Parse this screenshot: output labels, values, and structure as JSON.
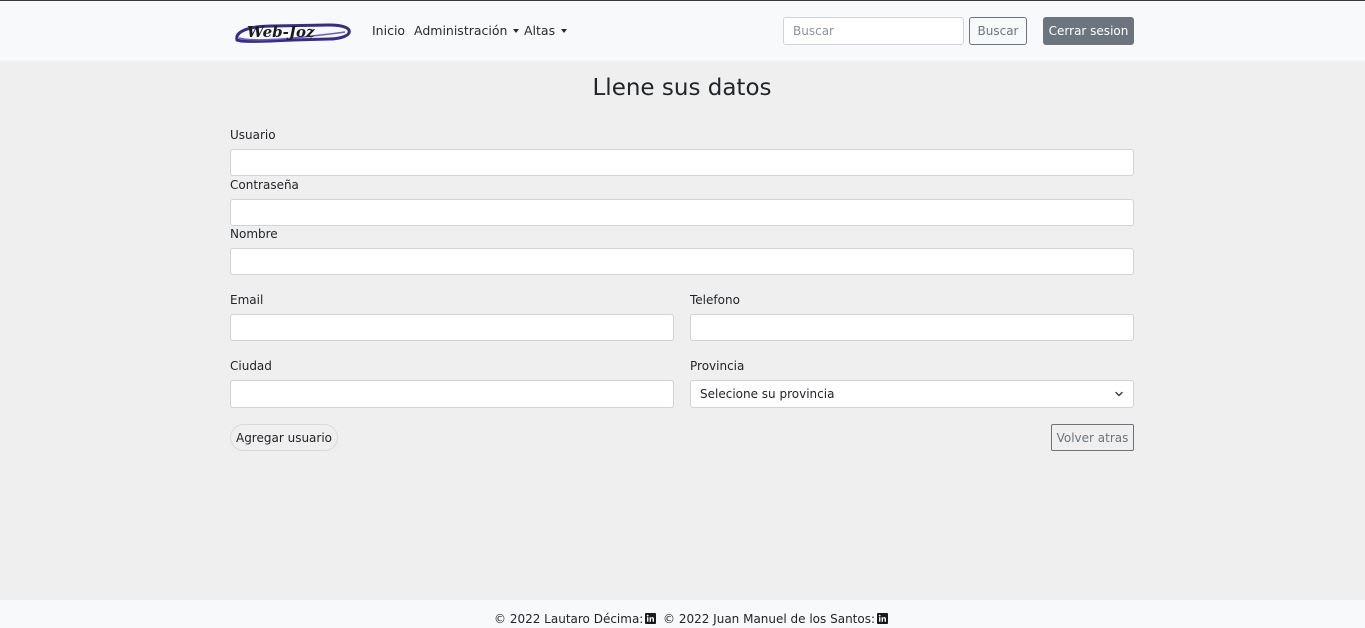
{
  "navbar": {
    "brand_text": "Web-Joz",
    "links": {
      "inicio": "Inicio",
      "administracion": "Administración",
      "altas": "Altas"
    },
    "search": {
      "placeholder": "Buscar",
      "value": ""
    },
    "search_button": "Buscar",
    "logout_button": "Cerrar sesion"
  },
  "form": {
    "title": "Llene sus datos",
    "fields": {
      "usuario": {
        "label": "Usuario",
        "value": ""
      },
      "contrasena": {
        "label": "Contraseña",
        "value": ""
      },
      "nombre": {
        "label": "Nombre",
        "value": ""
      },
      "email": {
        "label": "Email",
        "value": ""
      },
      "telefono": {
        "label": "Telefono",
        "value": ""
      },
      "ciudad": {
        "label": "Ciudad",
        "value": ""
      },
      "provincia": {
        "label": "Provincia",
        "selected": "Selecione su provincia"
      }
    },
    "add_button": "Agregar usuario",
    "back_button": "Volver atras"
  },
  "footer": {
    "credits": [
      {
        "text": "© 2022 Lautaro Décima:",
        "icon": "linkedin-icon"
      },
      {
        "text": "© 2022 Juan Manuel de los Santos:",
        "icon": "linkedin-icon"
      }
    ]
  },
  "colors": {
    "page_background": "#efefef",
    "navbar_background": "#f8f9fa",
    "secondary": "#6c757d",
    "brand_swoosh": "#3b2a8a"
  }
}
